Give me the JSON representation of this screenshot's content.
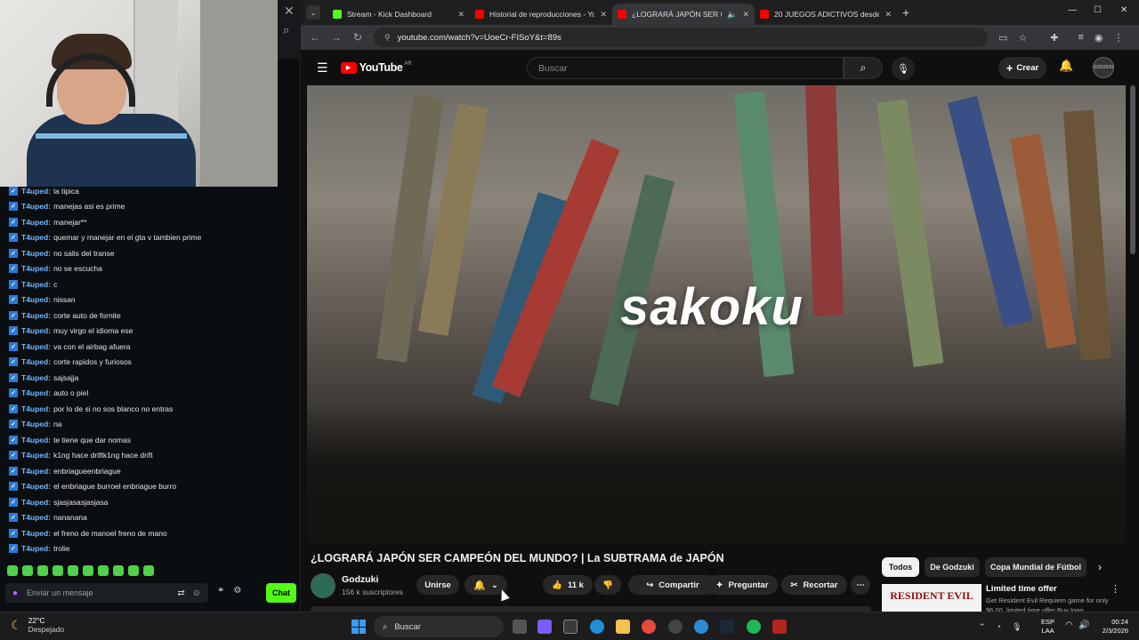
{
  "chat": {
    "messages": [
      {
        "user": "T4uped:",
        "text": "la tipica"
      },
      {
        "user": "T4uped:",
        "text": "manejas asi es prime"
      },
      {
        "user": "T4uped:",
        "text": "manejar**"
      },
      {
        "user": "T4uped:",
        "text": "quemar y manejar en el gta v tambien prime"
      },
      {
        "user": "T4uped:",
        "text": "no salis del transe"
      },
      {
        "user": "T4uped:",
        "text": "no se escucha"
      },
      {
        "user": "T4uped:",
        "text": "c"
      },
      {
        "user": "T4uped:",
        "text": "nissan"
      },
      {
        "user": "T4uped:",
        "text": "corte auto de fornite"
      },
      {
        "user": "T4uped:",
        "text": "muy virgo el idioma ese"
      },
      {
        "user": "T4uped:",
        "text": "va con el airbag afuera"
      },
      {
        "user": "T4uped:",
        "text": "corte rapidos y furiosos"
      },
      {
        "user": "T4uped:",
        "text": "sajsajja"
      },
      {
        "user": "T4uped:",
        "text": "auto o piel"
      },
      {
        "user": "T4uped:",
        "text": "por lo de si no sos blanco no entras"
      },
      {
        "user": "T4uped:",
        "text": "na"
      },
      {
        "user": "T4uped:",
        "text": "te tiene que dar nomas"
      },
      {
        "user": "T4uped:",
        "text": "k1ng hace driftk1ng hace drift"
      },
      {
        "user": "T4uped:",
        "text": "enbriagueenbriague"
      },
      {
        "user": "T4uped:",
        "text": "el enbriague burroel enbriague burro"
      },
      {
        "user": "T4uped:",
        "text": "sjasjasasjasjasa"
      },
      {
        "user": "T4uped:",
        "text": "nananana"
      },
      {
        "user": "T4uped:",
        "text": "el freno de manoel freno de mano"
      },
      {
        "user": "T4uped:",
        "text": "trolie"
      }
    ],
    "input_placeholder": "Enviar un mensaje",
    "send_label": "Chat",
    "accent": "#53fc18"
  },
  "browser": {
    "tabs": [
      {
        "title": "Stream - Kick Dashboard",
        "favicon_color": "#53fc18",
        "active": false
      },
      {
        "title": "Historial de reproducciones - Yo",
        "favicon_color": "#ff0000",
        "active": false
      },
      {
        "title": "¿LOGRARÁ JAPÓN SER CAM",
        "favicon_color": "#ff0000",
        "active": true
      },
      {
        "title": "20 JUEGOS ADICTIVOS desde l",
        "favicon_color": "#ff0000",
        "active": false
      }
    ],
    "url": "youtube.com/watch?v=UoeCr-FISoY&t=89s"
  },
  "youtube": {
    "logo": "YouTube",
    "country": "AR",
    "search_placeholder": "Buscar",
    "create_label": "Crear",
    "avatar_text": "GODZEKI",
    "overlay_text": "sakoku",
    "video_title": "¿LOGRARÁ JAPÓN SER CAMPEÓN DEL MUNDO? | La SUBTRAMA de JAPÓN",
    "channel": {
      "name": "Godzuki",
      "subs": "156 k suscriptores"
    },
    "join_label": "Unirse",
    "likes": "11 k",
    "share_label": "Compartir",
    "ask_label": "Preguntar",
    "clip_label": "Recortar",
    "chips": [
      "Todos",
      "De Godzuki",
      "Copa Mundial de Fútbol"
    ],
    "ad": {
      "thumb_text": "RESIDENT EVIL",
      "title": "Limited time offer",
      "desc": "Get Resident Evil Requiem game for only $6,00. limited time offer Buy Ioao"
    }
  },
  "taskbar": {
    "weather_temp": "22°C",
    "weather_desc": "Despejado",
    "search_label": "Buscar",
    "lang1": "ESP",
    "lang2": "LAA",
    "time": "00:24",
    "date": "2/3/2026"
  }
}
